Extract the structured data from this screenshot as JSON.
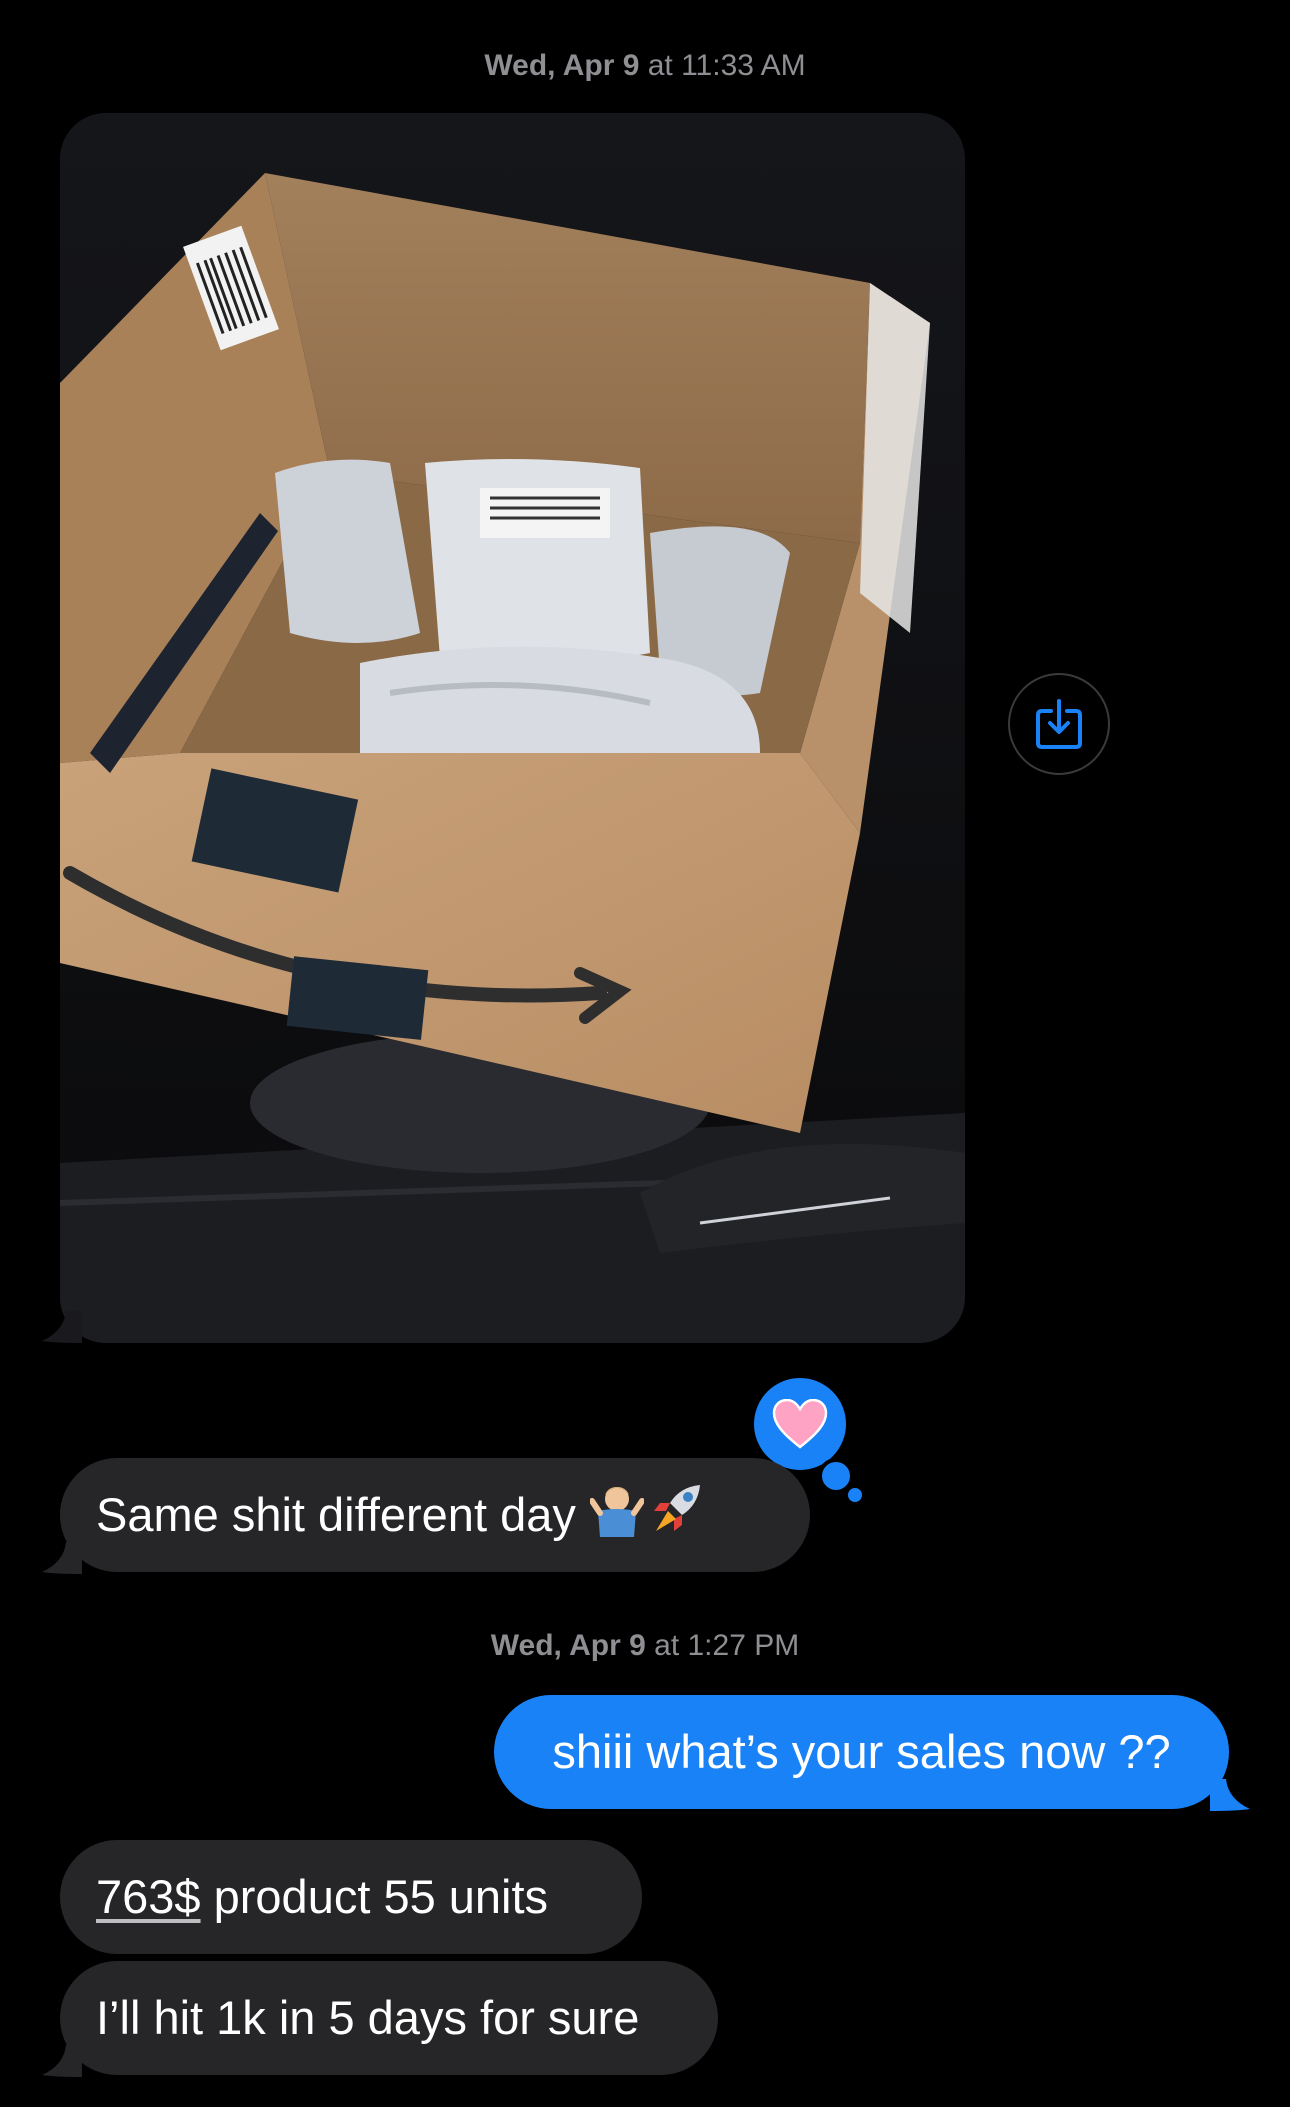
{
  "thread": {
    "timestamp1": {
      "day": "Wed, Apr 9",
      "time": "at 11:33 AM"
    },
    "timestamp2": {
      "day": "Wed, Apr 9",
      "time": "at 1:27 PM"
    }
  },
  "messages": [
    {
      "direction": "incoming",
      "type": "photo"
    },
    {
      "direction": "incoming",
      "text": "Same shit different day",
      "emoji": [
        "person-shrugging-emoji",
        "rocket-emoji"
      ],
      "reaction": "heart"
    },
    {
      "direction": "outgoing",
      "text": "shiii what’s your sales now ??"
    },
    {
      "direction": "incoming",
      "text_link": "763$",
      "text_rest": " product 55 units"
    },
    {
      "direction": "incoming",
      "text": "I’ll hit 1k in 5 days for sure"
    }
  ],
  "icons": {
    "save": "save-to-photos-icon",
    "reaction": "pink-heart-icon"
  },
  "colors": {
    "background": "#000000",
    "incoming_bubble": "#262628",
    "outgoing_bubble": "#1a82f7",
    "timestamp": "#8e8e93"
  }
}
